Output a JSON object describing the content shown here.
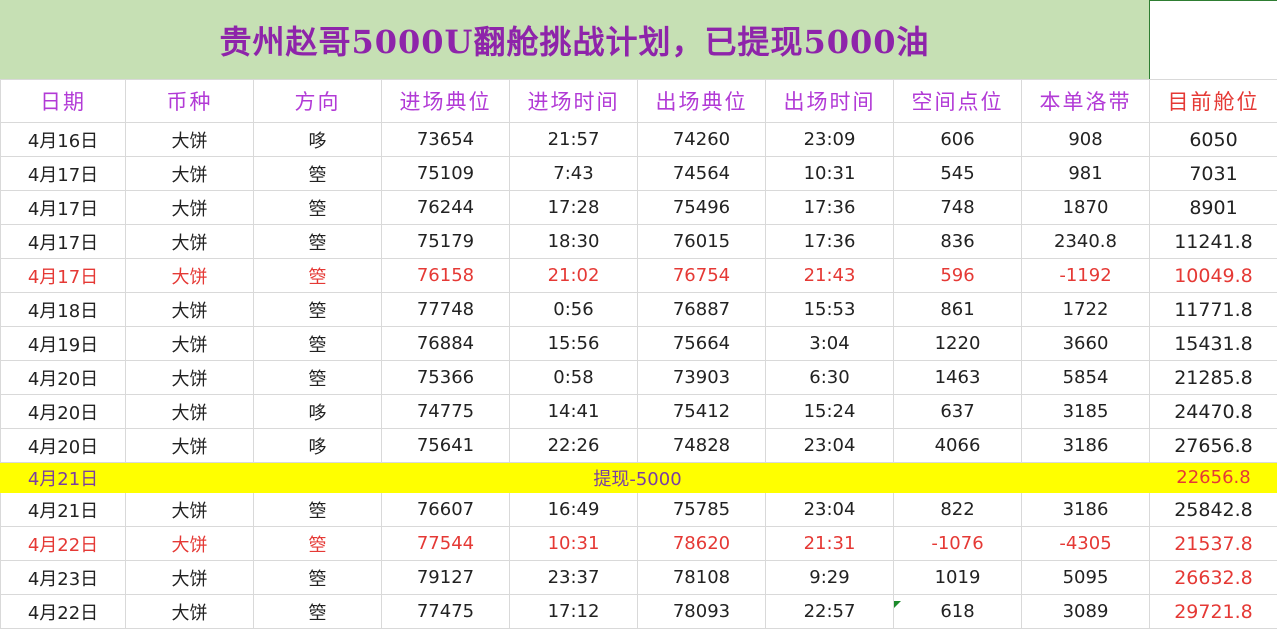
{
  "title": "贵州赵哥5000U翻舱挑战计划，已提现5000油",
  "headers": [
    "日期",
    "币种",
    "方向",
    "进场典位",
    "进场时间",
    "出场典位",
    "出场时间",
    "空间点位",
    "本单洛带",
    "目前舱位"
  ],
  "rows": [
    {
      "date": "4月16日",
      "coin": "大饼",
      "dir": "哆",
      "entry": "73654",
      "entry_time": "21:57",
      "exit": "74260",
      "exit_time": "23:09",
      "points": "606",
      "pnl": "908",
      "position": "6050"
    },
    {
      "date": "4月17日",
      "coin": "大饼",
      "dir": "箜",
      "entry": "75109",
      "entry_time": "7:43",
      "exit": "74564",
      "exit_time": "10:31",
      "points": "545",
      "pnl": "981",
      "position": "7031"
    },
    {
      "date": "4月17日",
      "coin": "大饼",
      "dir": "箜",
      "entry": "76244",
      "entry_time": "17:28",
      "exit": "75496",
      "exit_time": "17:36",
      "points": "748",
      "pnl": "1870",
      "position": "8901"
    },
    {
      "date": "4月17日",
      "coin": "大饼",
      "dir": "箜",
      "entry": "75179",
      "entry_time": "18:30",
      "exit": "76015",
      "exit_time": "17:36",
      "points": "836",
      "pnl": "2340.8",
      "position": "11241.8"
    },
    {
      "date": "4月17日",
      "coin": "大饼",
      "dir": "箜",
      "entry": "76158",
      "entry_time": "21:02",
      "exit": "76754",
      "exit_time": "21:43",
      "points": "596",
      "pnl": "-1192",
      "position": "10049.8",
      "style": "red"
    },
    {
      "date": "4月18日",
      "coin": "大饼",
      "dir": "箜",
      "entry": "77748",
      "entry_time": "0:56",
      "exit": "76887",
      "exit_time": "15:53",
      "points": "861",
      "pnl": "1722",
      "position": "11771.8"
    },
    {
      "date": "4月19日",
      "coin": "大饼",
      "dir": "箜",
      "entry": "76884",
      "entry_time": "15:56",
      "exit": "75664",
      "exit_time": "3:04",
      "points": "1220",
      "pnl": "3660",
      "position": "15431.8"
    },
    {
      "date": "4月20日",
      "coin": "大饼",
      "dir": "箜",
      "entry": "75366",
      "entry_time": "0:58",
      "exit": "73903",
      "exit_time": "6:30",
      "points": "1463",
      "pnl": "5854",
      "position": "21285.8"
    },
    {
      "date": "4月20日",
      "coin": "大饼",
      "dir": "哆",
      "entry": "74775",
      "entry_time": "14:41",
      "exit": "75412",
      "exit_time": "15:24",
      "points": "637",
      "pnl": "3185",
      "position": "24470.8"
    },
    {
      "date": "4月20日",
      "coin": "大饼",
      "dir": "哆",
      "entry": "75641",
      "entry_time": "22:26",
      "exit": "74828",
      "exit_time": "23:04",
      "points": "4066",
      "pnl": "3186",
      "position": "27656.8"
    }
  ],
  "withdraw": {
    "date": "4月21日",
    "note": "提现-5000",
    "position": "22656.8"
  },
  "rows_after": [
    {
      "date": "4月21日",
      "coin": "大饼",
      "dir": "箜",
      "entry": "76607",
      "entry_time": "16:49",
      "exit": "75785",
      "exit_time": "23:04",
      "points": "822",
      "pnl": "3186",
      "position": "25842.8"
    },
    {
      "date": "4月22日",
      "coin": "大饼",
      "dir": "箜",
      "entry": "77544",
      "entry_time": "10:31",
      "exit": "78620",
      "exit_time": "21:31",
      "points": "-1076",
      "pnl": "-4305",
      "position": "21537.8",
      "style": "red"
    },
    {
      "date": "4月23日",
      "coin": "大饼",
      "dir": "箜",
      "entry": "79127",
      "entry_time": "23:37",
      "exit": "78108",
      "exit_time": "9:29",
      "points": "1019",
      "pnl": "5095",
      "position": "26632.8",
      "style": "red-current"
    },
    {
      "date": "4月22日",
      "coin": "大饼",
      "dir": "箜",
      "entry": "77475",
      "entry_time": "17:12",
      "exit": "78093",
      "exit_time": "22:57",
      "points": "618",
      "pnl": "3089",
      "position": "29721.8",
      "style": "red-current"
    }
  ],
  "colors": {
    "title_bg": "#c6e0b4",
    "title_text": "#8e24aa",
    "header_text": "#b23ad6",
    "loss_red": "#e53935",
    "withdraw_bg": "#ffff00"
  }
}
